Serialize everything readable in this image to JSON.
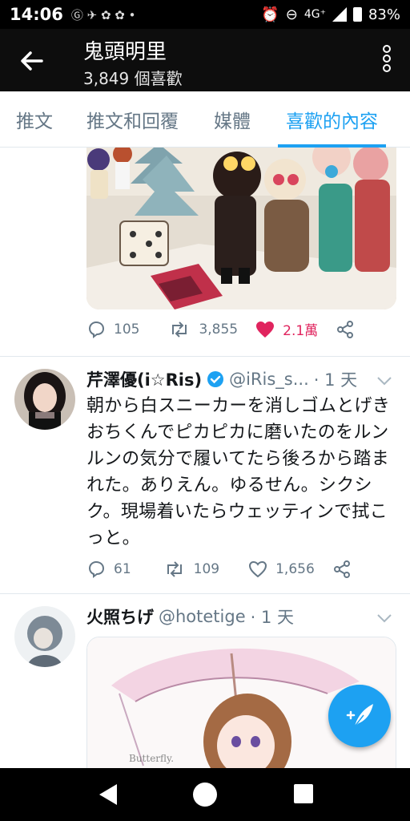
{
  "status_bar": {
    "time": "14:06",
    "network": "4G⁺",
    "battery": "83%"
  },
  "header": {
    "title": "鬼頭明里",
    "subtitle": "3,849 個喜歡"
  },
  "tabs": [
    {
      "label": "推文"
    },
    {
      "label": "推文和回覆"
    },
    {
      "label": "媒體"
    },
    {
      "label": "喜歡的內容"
    }
  ],
  "tweets": [
    {
      "reply_count": "105",
      "retweet_count": "3,855",
      "like_count": "2.1萬",
      "liked": true
    },
    {
      "name": "芹澤優(i☆Ris)",
      "handle": "@iRis_s...",
      "time": "· 1 天",
      "verified": true,
      "text": "朝から白スニーカーを消しゴムとげきおちくんでピカピカに磨いたのをルンルンの気分で履いてたら後ろから踏まれた。ありえん。ゆるせん。シクシク。現場着いたらウェッティンで拭こっと。",
      "reply_count": "61",
      "retweet_count": "109",
      "like_count": "1,656"
    },
    {
      "name": "火照ちげ",
      "handle": "@hotetige",
      "time": "· 1 天",
      "image_caption": "Butterfly."
    }
  ],
  "colors": {
    "accent": "#1da1f2",
    "like": "#e0245e",
    "muted": "#657786"
  }
}
